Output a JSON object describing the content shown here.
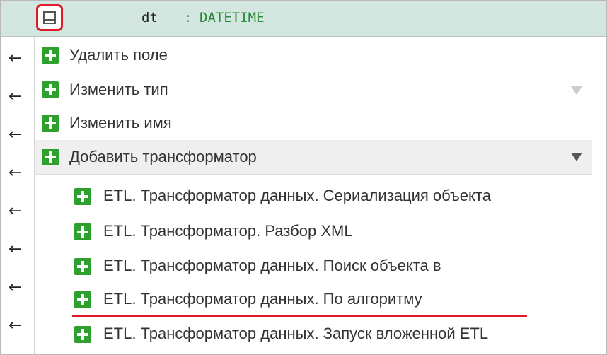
{
  "field": {
    "name": "dt",
    "colon": ":",
    "type": "DATETIME"
  },
  "colors": {
    "accent_red": "#e21b2a",
    "plus_green": "#2ea02e",
    "header_bg": "#d3e7e0",
    "type_green": "#2a8a3a"
  },
  "menu": {
    "items": [
      {
        "label": "Удалить поле"
      },
      {
        "label": "Изменить тип"
      },
      {
        "label": "Изменить имя"
      },
      {
        "label": "Добавить трансформатор"
      }
    ],
    "submenu": [
      {
        "label": "ETL. Трансформатор данных. Сериализация объекта"
      },
      {
        "label": "ETL. Трансформатор. Разбор XML"
      },
      {
        "label": "ETL. Трансформатор данных. Поиск объекта в"
      },
      {
        "label": "ETL. Трансформатор данных. По алгоритму"
      },
      {
        "label": "ETL. Трансформатор данных. Запуск вложенной ETL"
      }
    ]
  },
  "icons": {
    "row_icon": "arrow-left-icon",
    "item_icon": "plus-icon",
    "collapse": "collapse-square-icon"
  }
}
